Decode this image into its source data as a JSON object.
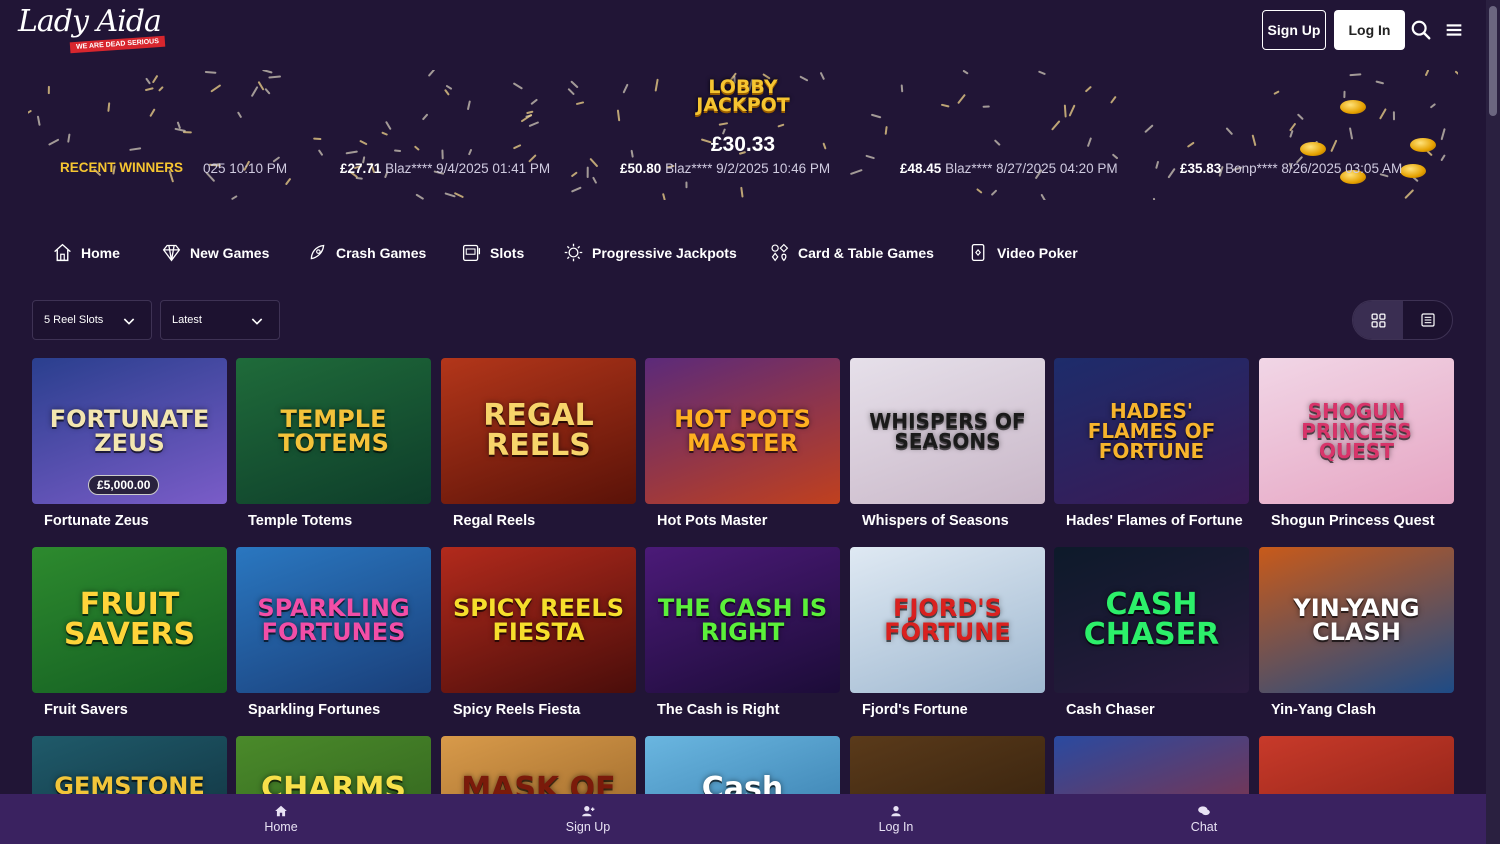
{
  "header": {
    "logo_text": "Lady Aida",
    "logo_tagline": "WE ARE DEAD SERIOUS",
    "signup_label": "Sign Up",
    "login_label": "Log In"
  },
  "jackpot": {
    "logo_line1": "LOBBY",
    "logo_line2": "JACKPOT",
    "amount": "£30.33",
    "recent_label": "RECENT WINNERS",
    "winners": [
      {
        "amount": "",
        "text": "025 10:10 PM"
      },
      {
        "amount": "£27.71",
        "text": "Blaz**** 9/4/2025 01:41 PM"
      },
      {
        "amount": "£50.80",
        "text": "Blaz**** 9/2/2025 10:46 PM"
      },
      {
        "amount": "£48.45",
        "text": "Blaz**** 8/27/2025 04:20 PM"
      },
      {
        "amount": "£35.83",
        "text": "Bonp**** 8/26/2025 03:05 AM"
      }
    ]
  },
  "nav": {
    "items": [
      {
        "label": "Home",
        "icon": "home-icon"
      },
      {
        "label": "New Games",
        "icon": "diamond-icon"
      },
      {
        "label": "Crash Games",
        "icon": "rocket-icon"
      },
      {
        "label": "Slots",
        "icon": "slot-machine-icon"
      },
      {
        "label": "Progressive Jackpots",
        "icon": "sparkle-icon"
      },
      {
        "label": "Card & Table Games",
        "icon": "cards-icon"
      },
      {
        "label": "Video Poker",
        "icon": "poker-icon"
      }
    ]
  },
  "filters": {
    "category_value": "5 Reel Slots",
    "sort_value": "Latest"
  },
  "games": [
    {
      "name": "Fortunate Zeus",
      "thumb_text": "FORTUNATE ZEUS",
      "prize": "£5,000.00",
      "colors": [
        "#2a3f8e",
        "#7a5cc8"
      ],
      "text_color": "#f3e6b0"
    },
    {
      "name": "Temple Totems",
      "thumb_text": "TEMPLE TOTEMS",
      "prize": "",
      "colors": [
        "#1f6b3a",
        "#0e3d2a"
      ],
      "text_color": "#f4c23a"
    },
    {
      "name": "Regal Reels",
      "thumb_text": "REGAL REELS",
      "prize": "",
      "colors": [
        "#b3361a",
        "#5a1208"
      ],
      "text_color": "#f7d46a"
    },
    {
      "name": "Hot Pots Master",
      "thumb_text": "HOT POTS MASTER",
      "prize": "",
      "colors": [
        "#5b2a7a",
        "#c0401e"
      ],
      "text_color": "#ffb020"
    },
    {
      "name": "Whispers of Seasons",
      "thumb_text": "WHISPERS OF SEASONS",
      "prize": "",
      "colors": [
        "#e6e0ea",
        "#c9b7c8"
      ],
      "text_color": "#1a1a1a"
    },
    {
      "name": "Hades' Flames of Fortune",
      "thumb_text": "HADES' FLAMES OF FORTUNE",
      "prize": "",
      "colors": [
        "#1d2c6b",
        "#3b1a55"
      ],
      "text_color": "#f7b42c"
    },
    {
      "name": "Shogun Princess Quest",
      "thumb_text": "SHOGUN PRINCESS QUEST",
      "prize": "",
      "colors": [
        "#f1d6e6",
        "#e6a5c3"
      ],
      "text_color": "#d8346a"
    },
    {
      "name": "Fruit Savers",
      "thumb_text": "FRUIT SAVERS",
      "prize": "",
      "colors": [
        "#2d8a2e",
        "#145e22"
      ],
      "text_color": "#ffd43a"
    },
    {
      "name": "Sparkling Fortunes",
      "thumb_text": "SPARKLING FORTUNES",
      "prize": "",
      "colors": [
        "#2a77c0",
        "#1a3f7a"
      ],
      "text_color": "#f24ea7"
    },
    {
      "name": "Spicy Reels Fiesta",
      "thumb_text": "SPICY REELS FIESTA",
      "prize": "",
      "colors": [
        "#b22a1c",
        "#4a0d0a"
      ],
      "text_color": "#f6df2c"
    },
    {
      "name": "The Cash is Right",
      "thumb_text": "THE CASH IS RIGHT",
      "prize": "",
      "colors": [
        "#4b1a78",
        "#1c0c38"
      ],
      "text_color": "#5bf03a"
    },
    {
      "name": "Fjord's Fortune",
      "thumb_text": "FJORD'S FORTUNE",
      "prize": "",
      "colors": [
        "#dfe9f3",
        "#9fb8d0"
      ],
      "text_color": "#d9211f"
    },
    {
      "name": "Cash Chaser",
      "thumb_text": "CASH CHASER",
      "prize": "",
      "colors": [
        "#0d1a2a",
        "#2a1a3e"
      ],
      "text_color": "#2cf06a"
    },
    {
      "name": "Yin-Yang Clash",
      "thumb_text": "YIN-YANG CLASH",
      "prize": "",
      "colors": [
        "#c85a1a",
        "#1e4b86"
      ],
      "text_color": "#ffffff"
    },
    {
      "name": "",
      "thumb_text": "GEMSTONE KEYS",
      "prize": "",
      "colors": [
        "#1f5a6a",
        "#0e2a36"
      ],
      "text_color": "#f2c53a"
    },
    {
      "name": "",
      "thumb_text": "CHARMS",
      "prize": "",
      "colors": [
        "#4a8a2a",
        "#2d5a1c"
      ],
      "text_color": "#f7e04a"
    },
    {
      "name": "",
      "thumb_text": "MASK OF THE",
      "prize": "",
      "colors": [
        "#d89a4a",
        "#8a5a22"
      ],
      "text_color": "#7a1a0a"
    },
    {
      "name": "",
      "thumb_text": "Cash",
      "prize": "",
      "colors": [
        "#6ab6e0",
        "#2a6ea0"
      ],
      "text_color": "#ffffff"
    },
    {
      "name": "",
      "thumb_text": "",
      "prize": "",
      "colors": [
        "#5a3a1a",
        "#2a1a0a"
      ],
      "text_color": "#f2c53a"
    },
    {
      "name": "",
      "thumb_text": "",
      "prize": "",
      "colors": [
        "#2a4aa0",
        "#a02a2a"
      ],
      "text_color": "#ffffff"
    },
    {
      "name": "",
      "thumb_text": "",
      "prize": "",
      "colors": [
        "#c83a2a",
        "#7a1a10"
      ],
      "text_color": "#ffffff"
    }
  ],
  "bottom_bar": {
    "items": [
      {
        "label": "Home",
        "icon": "home-icon"
      },
      {
        "label": "Sign Up",
        "icon": "add-user-icon"
      },
      {
        "label": "Log In",
        "icon": "user-icon"
      },
      {
        "label": "Chat",
        "icon": "chat-icon"
      }
    ]
  },
  "colors": {
    "background": "#211536",
    "accent_gold": "#f6c531",
    "bottom_bar": "#3a2260"
  }
}
